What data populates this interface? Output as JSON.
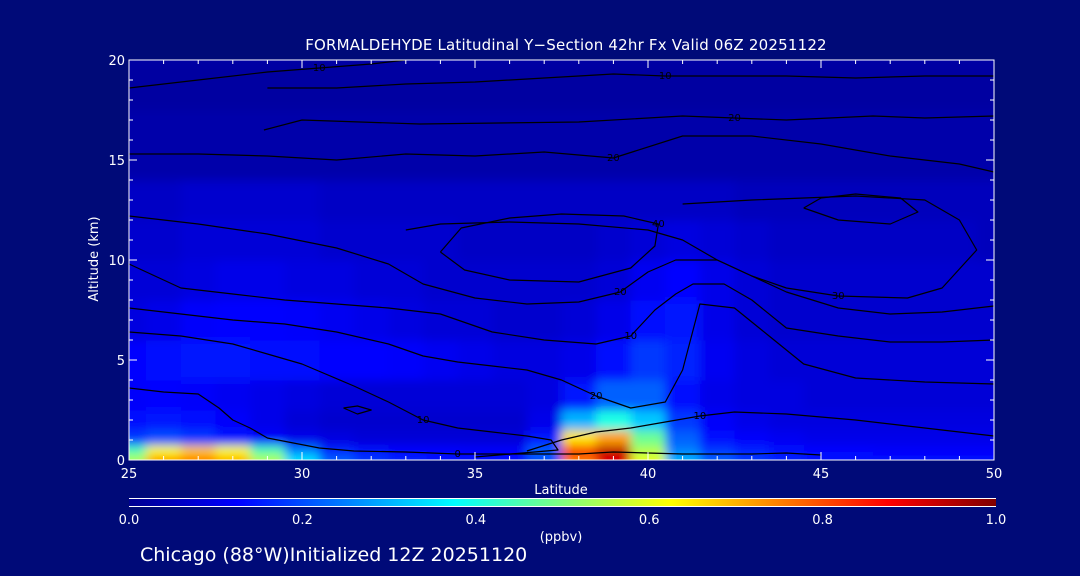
{
  "chart_data": {
    "type": "heatmap",
    "title": "FORMALDEHYDE Latitudinal Y−Section 42hr  Fx Valid 06Z 20251122",
    "xlabel": "Latitude",
    "ylabel": "Altitude (km)",
    "xlim": [
      25,
      50
    ],
    "ylim": [
      0,
      20
    ],
    "xticks": [
      "25",
      "30",
      "35",
      "40",
      "45",
      "50"
    ],
    "yticks": [
      "0",
      "5",
      "10",
      "15",
      "20"
    ],
    "colorbar": {
      "label": "(ppbv)",
      "range": [
        0.0,
        1.0
      ],
      "ticks": [
        "0.0",
        "0.2",
        "0.4",
        "0.6",
        "0.8",
        "1.0"
      ],
      "colormap": "jet"
    },
    "field": {
      "latitudes": [
        25,
        26,
        27,
        28,
        29,
        30,
        31,
        32,
        33,
        34,
        35,
        36,
        37,
        38,
        39,
        40,
        41,
        42,
        43,
        44,
        45,
        46,
        47,
        48,
        49,
        50
      ],
      "altitudes_km": [
        0,
        0.5,
        1,
        2,
        3,
        5,
        7,
        9,
        11,
        13,
        15,
        20
      ],
      "values_ppbv": [
        [
          0.55,
          0.72,
          0.75,
          0.7,
          0.55,
          0.35,
          0.22,
          0.18,
          0.16,
          0.15,
          0.14,
          0.14,
          0.2,
          0.75,
          0.9,
          0.6,
          0.3,
          0.22,
          0.18,
          0.16,
          0.15,
          0.15,
          0.14,
          0.14,
          0.14,
          0.14
        ],
        [
          0.45,
          0.62,
          0.68,
          0.62,
          0.45,
          0.25,
          0.16,
          0.14,
          0.13,
          0.13,
          0.12,
          0.12,
          0.22,
          0.88,
          0.95,
          0.55,
          0.25,
          0.18,
          0.16,
          0.14,
          0.13,
          0.13,
          0.12,
          0.12,
          0.12,
          0.12
        ],
        [
          0.18,
          0.2,
          0.18,
          0.15,
          0.12,
          0.1,
          0.09,
          0.08,
          0.08,
          0.08,
          0.08,
          0.08,
          0.15,
          0.65,
          0.72,
          0.48,
          0.22,
          0.14,
          0.12,
          0.11,
          0.1,
          0.1,
          0.1,
          0.1,
          0.1,
          0.1
        ],
        [
          0.14,
          0.15,
          0.14,
          0.12,
          0.1,
          0.08,
          0.07,
          0.07,
          0.07,
          0.07,
          0.07,
          0.07,
          0.1,
          0.3,
          0.4,
          0.32,
          0.18,
          0.12,
          0.1,
          0.09,
          0.09,
          0.09,
          0.09,
          0.09,
          0.09,
          0.09
        ],
        [
          0.12,
          0.13,
          0.12,
          0.11,
          0.1,
          0.09,
          0.08,
          0.08,
          0.08,
          0.08,
          0.08,
          0.08,
          0.09,
          0.15,
          0.22,
          0.22,
          0.14,
          0.1,
          0.09,
          0.09,
          0.08,
          0.08,
          0.08,
          0.08,
          0.08,
          0.08
        ],
        [
          0.13,
          0.14,
          0.15,
          0.15,
          0.14,
          0.14,
          0.13,
          0.13,
          0.12,
          0.11,
          0.1,
          0.09,
          0.09,
          0.1,
          0.14,
          0.18,
          0.16,
          0.11,
          0.09,
          0.08,
          0.08,
          0.08,
          0.08,
          0.08,
          0.08,
          0.08
        ],
        [
          0.09,
          0.1,
          0.12,
          0.13,
          0.13,
          0.12,
          0.11,
          0.1,
          0.09,
          0.08,
          0.08,
          0.07,
          0.07,
          0.08,
          0.1,
          0.14,
          0.15,
          0.1,
          0.08,
          0.07,
          0.07,
          0.07,
          0.07,
          0.07,
          0.07,
          0.07
        ],
        [
          0.08,
          0.08,
          0.09,
          0.1,
          0.1,
          0.09,
          0.09,
          0.08,
          0.08,
          0.07,
          0.07,
          0.07,
          0.07,
          0.07,
          0.08,
          0.11,
          0.13,
          0.1,
          0.08,
          0.07,
          0.07,
          0.07,
          0.07,
          0.07,
          0.07,
          0.07
        ],
        [
          0.07,
          0.07,
          0.08,
          0.08,
          0.08,
          0.08,
          0.07,
          0.07,
          0.07,
          0.07,
          0.06,
          0.06,
          0.06,
          0.06,
          0.07,
          0.08,
          0.09,
          0.08,
          0.07,
          0.06,
          0.06,
          0.06,
          0.06,
          0.06,
          0.06,
          0.05
        ],
        [
          0.06,
          0.06,
          0.07,
          0.07,
          0.07,
          0.07,
          0.06,
          0.06,
          0.06,
          0.06,
          0.06,
          0.06,
          0.06,
          0.06,
          0.06,
          0.06,
          0.06,
          0.06,
          0.05,
          0.05,
          0.05,
          0.05,
          0.05,
          0.05,
          0.05,
          0.05
        ],
        [
          0.03,
          0.03,
          0.03,
          0.03,
          0.03,
          0.03,
          0.03,
          0.03,
          0.03,
          0.03,
          0.03,
          0.03,
          0.03,
          0.03,
          0.03,
          0.03,
          0.03,
          0.03,
          0.03,
          0.03,
          0.03,
          0.03,
          0.03,
          0.03,
          0.03,
          0.03
        ],
        [
          0.02,
          0.02,
          0.02,
          0.02,
          0.02,
          0.02,
          0.02,
          0.02,
          0.02,
          0.02,
          0.02,
          0.02,
          0.02,
          0.02,
          0.02,
          0.02,
          0.02,
          0.02,
          0.02,
          0.02,
          0.02,
          0.02,
          0.02,
          0.02,
          0.02,
          0.02
        ]
      ]
    },
    "contours": [
      {
        "label": "0",
        "points": [
          [
            25,
            3.6
          ],
          [
            26,
            3.4
          ],
          [
            27,
            3.3
          ],
          [
            27.6,
            2.6
          ],
          [
            28,
            2.0
          ],
          [
            28.5,
            1.6
          ],
          [
            29,
            1.1
          ],
          [
            29.6,
            0.9
          ],
          [
            30.5,
            0.6
          ],
          [
            31.5,
            0.45
          ],
          [
            33,
            0.4
          ],
          [
            34.5,
            0.3
          ],
          [
            36,
            0.3
          ],
          [
            37,
            0.3
          ],
          [
            38,
            0.3
          ],
          [
            39,
            0.4
          ],
          [
            40,
            0.35
          ],
          [
            41,
            0.3
          ],
          [
            42,
            0.3
          ],
          [
            43,
            0.3
          ],
          [
            44,
            0.35
          ],
          [
            45,
            0.25
          ]
        ]
      },
      {
        "label": "10",
        "points": [
          [
            25,
            6.4
          ],
          [
            26.5,
            6.2
          ],
          [
            28,
            5.8
          ],
          [
            29,
            5.3
          ],
          [
            30,
            4.8
          ],
          [
            31.5,
            3.7
          ],
          [
            32.5,
            2.9
          ],
          [
            33.5,
            2.0
          ],
          [
            34.5,
            1.6
          ],
          [
            35.5,
            1.4
          ],
          [
            36.5,
            1.2
          ],
          [
            37.2,
            1.0
          ],
          [
            37.4,
            0.5
          ],
          [
            35,
            0.15
          ]
        ]
      },
      {
        "label": "10",
        "points": [
          [
            36.5,
            0.45
          ],
          [
            37.5,
            1.0
          ],
          [
            38.5,
            1.4
          ],
          [
            39.5,
            1.6
          ],
          [
            40.5,
            1.9
          ],
          [
            41.5,
            2.2
          ],
          [
            42.5,
            2.4
          ],
          [
            44,
            2.3
          ],
          [
            46,
            2.0
          ],
          [
            48,
            1.6
          ],
          [
            50,
            1.2
          ]
        ]
      },
      {
        "label": "20",
        "points": [
          [
            25,
            7.6
          ],
          [
            26.5,
            7.3
          ],
          [
            28,
            7.0
          ],
          [
            29.5,
            6.8
          ],
          [
            31,
            6.4
          ],
          [
            32.5,
            5.8
          ],
          [
            33.5,
            5.2
          ],
          [
            34.5,
            4.9
          ],
          [
            35.5,
            4.7
          ],
          [
            36.5,
            4.5
          ],
          [
            37.5,
            4.0
          ],
          [
            38.5,
            3.2
          ],
          [
            39.5,
            2.6
          ],
          [
            40.5,
            2.9
          ],
          [
            41,
            4.5
          ],
          [
            41.5,
            7.8
          ],
          [
            42.5,
            7.6
          ],
          [
            43.5,
            6.2
          ],
          [
            44.5,
            4.8
          ],
          [
            46,
            4.1
          ],
          [
            48,
            3.9
          ],
          [
            50,
            3.8
          ]
        ]
      },
      {
        "label": "10",
        "points": [
          [
            25,
            9.8
          ],
          [
            26.5,
            8.6
          ],
          [
            28,
            8.3
          ],
          [
            29.5,
            8.0
          ],
          [
            31,
            7.8
          ],
          [
            32.5,
            7.6
          ],
          [
            34,
            7.3
          ],
          [
            35.5,
            6.4
          ],
          [
            37,
            6.0
          ],
          [
            38.5,
            5.8
          ],
          [
            39.5,
            6.2
          ],
          [
            40.2,
            7.5
          ],
          [
            40.8,
            8.3
          ],
          [
            41.3,
            8.8
          ],
          [
            42.2,
            8.8
          ],
          [
            43,
            8.0
          ],
          [
            44,
            6.6
          ],
          [
            45.5,
            6.2
          ],
          [
            47,
            5.9
          ],
          [
            48.5,
            5.9
          ],
          [
            50,
            6.0
          ]
        ]
      },
      {
        "label": "20",
        "points": [
          [
            25,
            12.2
          ],
          [
            27,
            11.8
          ],
          [
            29,
            11.3
          ],
          [
            31,
            10.6
          ],
          [
            32.5,
            9.8
          ],
          [
            33.5,
            8.8
          ],
          [
            35,
            8.1
          ],
          [
            36.5,
            7.8
          ],
          [
            38,
            7.9
          ],
          [
            39.2,
            8.4
          ],
          [
            40,
            9.4
          ],
          [
            40.8,
            10.0
          ],
          [
            42,
            10.0
          ],
          [
            43,
            9.2
          ],
          [
            44,
            8.4
          ],
          [
            45.5,
            7.6
          ],
          [
            47,
            7.3
          ],
          [
            48.5,
            7.4
          ],
          [
            50,
            7.7
          ]
        ]
      },
      {
        "label": "30",
        "points": [
          [
            33,
            11.5
          ],
          [
            34,
            11.8
          ],
          [
            36,
            11.9
          ],
          [
            38,
            11.8
          ],
          [
            40,
            11.5
          ],
          [
            41,
            11.0
          ],
          [
            42,
            10.0
          ],
          [
            43,
            9.2
          ],
          [
            44,
            8.6
          ],
          [
            45.5,
            8.2
          ],
          [
            47.5,
            8.1
          ],
          [
            48.5,
            8.6
          ],
          [
            49.5,
            10.5
          ],
          [
            49,
            12.0
          ],
          [
            48,
            13.0
          ],
          [
            46,
            13.2
          ],
          [
            43,
            13.0
          ],
          [
            41,
            12.8
          ]
        ]
      },
      {
        "label": "40",
        "points": [
          [
            34,
            10.4
          ],
          [
            34.7,
            9.5
          ],
          [
            36,
            9.0
          ],
          [
            38,
            8.9
          ],
          [
            39.5,
            9.6
          ],
          [
            40.2,
            10.7
          ],
          [
            40.3,
            11.8
          ],
          [
            39.3,
            12.2
          ],
          [
            37.5,
            12.3
          ],
          [
            36,
            12.1
          ],
          [
            34.6,
            11.6
          ],
          [
            34,
            10.4
          ]
        ]
      },
      {
        "label": "",
        "points": [
          [
            44.5,
            12.6
          ],
          [
            45.5,
            12.0
          ],
          [
            47,
            11.8
          ],
          [
            47.8,
            12.4
          ],
          [
            47.3,
            13.1
          ],
          [
            46,
            13.3
          ],
          [
            45,
            13.1
          ],
          [
            44.5,
            12.6
          ]
        ]
      },
      {
        "label": "20",
        "points": [
          [
            25,
            15.3
          ],
          [
            27,
            15.3
          ],
          [
            29,
            15.2
          ],
          [
            31,
            15.0
          ],
          [
            33,
            15.3
          ],
          [
            35,
            15.2
          ],
          [
            37,
            15.4
          ],
          [
            39,
            15.1
          ],
          [
            41,
            16.2
          ],
          [
            43,
            16.2
          ],
          [
            45,
            15.8
          ],
          [
            47,
            15.2
          ],
          [
            49,
            14.8
          ],
          [
            50,
            14.4
          ]
        ]
      },
      {
        "label": "20",
        "points": [
          [
            28.9,
            16.5
          ],
          [
            30,
            17.0
          ],
          [
            33.4,
            16.8
          ],
          [
            38,
            16.9
          ],
          [
            41,
            17.2
          ],
          [
            42.5,
            17.1
          ],
          [
            44,
            17.0
          ],
          [
            46.5,
            17.2
          ],
          [
            48,
            17.1
          ],
          [
            50,
            17.2
          ]
        ]
      },
      {
        "label": "10",
        "points": [
          [
            25,
            18.6
          ],
          [
            27,
            19.0
          ],
          [
            29,
            19.4
          ],
          [
            30.5,
            19.6
          ],
          [
            32,
            19.8
          ],
          [
            33,
            20
          ]
        ]
      },
      {
        "label": "10",
        "points": [
          [
            29,
            18.6
          ],
          [
            31,
            18.6
          ],
          [
            33,
            18.8
          ],
          [
            35,
            18.9
          ],
          [
            37,
            19.1
          ],
          [
            39,
            19.3
          ],
          [
            40.5,
            19.2
          ],
          [
            42,
            19.2
          ],
          [
            44,
            19.2
          ],
          [
            46,
            19.1
          ],
          [
            48,
            19.2
          ],
          [
            50,
            19.2
          ]
        ]
      },
      {
        "label": "",
        "points": [
          [
            31.2,
            2.6
          ],
          [
            31.6,
            2.3
          ],
          [
            32.0,
            2.5
          ],
          [
            31.6,
            2.7
          ],
          [
            31.2,
            2.6
          ]
        ]
      }
    ]
  },
  "footer": {
    "location": "Chicago (88°W)Initialized 12Z 20251120"
  }
}
